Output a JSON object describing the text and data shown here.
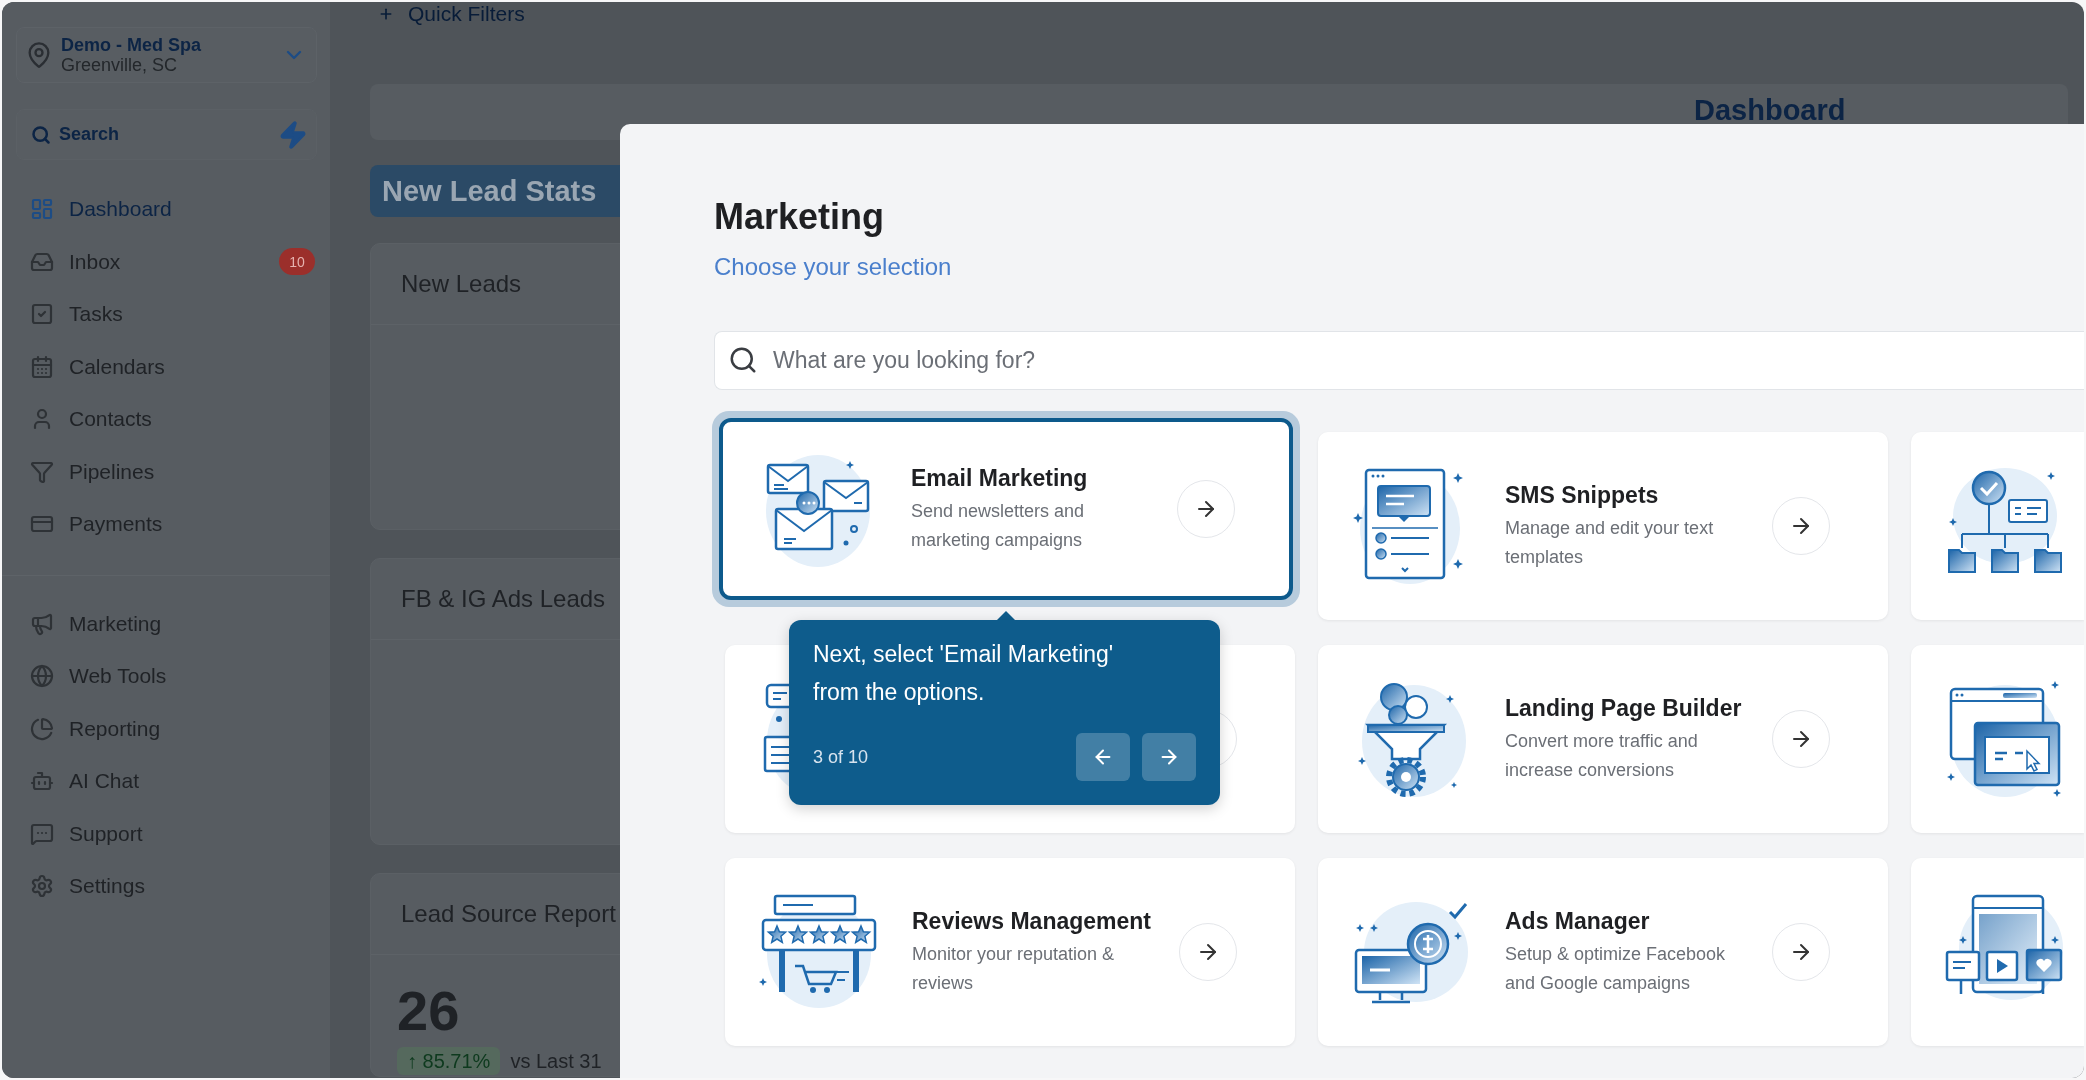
{
  "sidebar": {
    "location": {
      "name": "Demo - Med Spa",
      "city": "Greenville, SC"
    },
    "search": {
      "label": "Search"
    },
    "nav_main": [
      {
        "label": "Dashboard",
        "selected": true
      },
      {
        "label": "Inbox",
        "selected": false,
        "badge": "10"
      },
      {
        "label": "Tasks",
        "selected": false
      },
      {
        "label": "Calendars",
        "selected": false
      },
      {
        "label": "Contacts",
        "selected": false
      },
      {
        "label": "Pipelines",
        "selected": false
      },
      {
        "label": "Payments",
        "selected": false
      }
    ],
    "nav_secondary": [
      {
        "label": "Marketing",
        "selected": false
      },
      {
        "label": "Web Tools",
        "selected": false
      },
      {
        "label": "Reporting",
        "selected": false
      },
      {
        "label": "AI Chat",
        "selected": false
      },
      {
        "label": "Support",
        "selected": false
      },
      {
        "label": "Settings",
        "selected": false
      }
    ]
  },
  "header": {
    "quick_filters": "Quick Filters",
    "title": "Dashboard"
  },
  "dashboard": {
    "section": "New Lead Stats",
    "cards": [
      {
        "title": "New Leads"
      },
      {
        "title": "FB & IG Ads Leads"
      },
      {
        "title": "Lead Source Report",
        "value": "26",
        "change": "↑ 85.71%",
        "comparison": "vs Last 31"
      }
    ]
  },
  "modal": {
    "title": "Marketing",
    "subtitle": "Choose your selection",
    "search": {
      "placeholder": "What are you looking for?"
    },
    "options": [
      {
        "kind": "option",
        "title": "Email Marketing",
        "description": "Send newsletters and marketing campaigns",
        "highlighted": true
      },
      {
        "kind": "option",
        "title": "SMS Snippets",
        "description": "Manage and edit your text templates",
        "highlighted": false
      },
      {
        "kind": "cut",
        "highlighted": false
      },
      {
        "kind": "covered",
        "highlighted": false
      },
      {
        "kind": "option",
        "title": "Landing Page Builder",
        "description": "Convert more traffic and increase conversions",
        "highlighted": false
      },
      {
        "kind": "cut",
        "highlighted": false
      },
      {
        "kind": "option",
        "title": "Reviews Management",
        "description": "Monitor your reputation & reviews",
        "highlighted": false
      },
      {
        "kind": "option",
        "title": "Ads Manager",
        "description": "Setup & optimize Facebook and Google campaigns",
        "highlighted": false
      },
      {
        "kind": "cut",
        "highlighted": false
      }
    ]
  },
  "tour_tooltip": {
    "text": "Next, select 'Email Marketing' from the options.",
    "step": "3 of 10"
  }
}
